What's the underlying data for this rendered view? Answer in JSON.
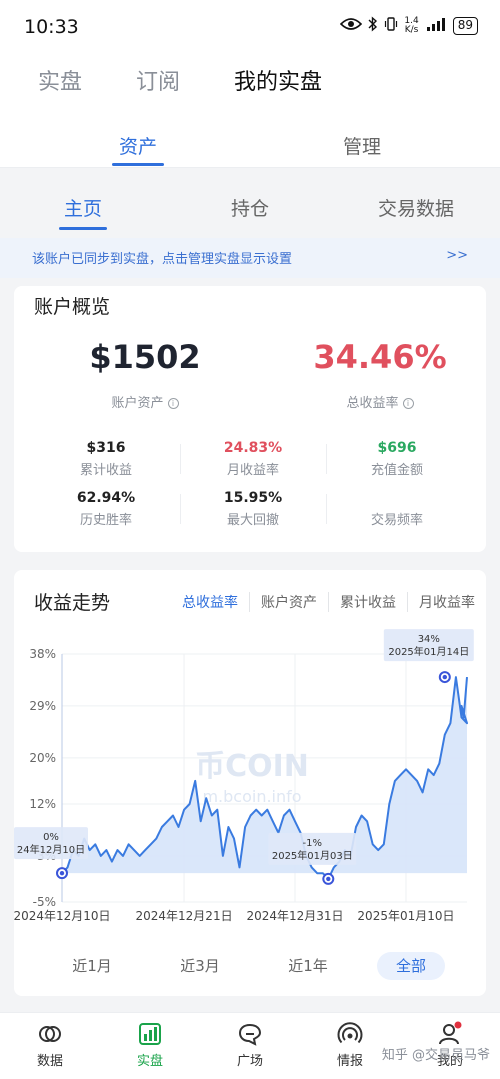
{
  "status": {
    "time": "10:33",
    "speed_top": "1.4",
    "speed_bottom": "K/s",
    "battery": "89"
  },
  "top_nav": {
    "items": [
      "实盘",
      "订阅",
      "我的实盘"
    ],
    "active": 2
  },
  "sub_tabs": [
    "资产",
    "管理"
  ],
  "inner_tabs": [
    "主页",
    "持仓",
    "交易数据"
  ],
  "banner": {
    "text": "该账户已同步到实盘，点击管理实盘显示设置",
    "more": ">>"
  },
  "overview": {
    "title": "账户概览",
    "asset_value": "$1502",
    "asset_label": "账户资产",
    "return_value": "34.46%",
    "return_label": "总收益率",
    "info_glyph": "i",
    "stats": [
      {
        "value": "$316",
        "label": "累计收益",
        "color": "#222222"
      },
      {
        "value": "24.83%",
        "label": "月收益率",
        "color": "#e0505e"
      },
      {
        "value": "$696",
        "label": "充值金额",
        "color": "#2aa860"
      },
      {
        "value": "62.94%",
        "label": "历史胜率",
        "color": "#222222"
      },
      {
        "value": "15.95%",
        "label": "最大回撤",
        "color": "#222222"
      },
      {
        "value": "",
        "label": "交易频率",
        "color": "#222222"
      }
    ]
  },
  "trend": {
    "title": "收益走势",
    "tabs": [
      "总收益率",
      "账户资产",
      "累计收益",
      "月收益率"
    ],
    "ranges": [
      "近1月",
      "近3月",
      "近1年",
      "全部"
    ],
    "active_range": 3
  },
  "chart_data": {
    "type": "area",
    "y_ticks": [
      "38%",
      "29%",
      "20%",
      "12%",
      "3%",
      "-5%"
    ],
    "y_tick_values": [
      38,
      29,
      20,
      12,
      3,
      -5
    ],
    "ylim": [
      -5,
      38
    ],
    "x_ticks": [
      "2024年12月10日",
      "2024年12月21日",
      "2024年12月31日",
      "2025年01月10日"
    ],
    "x_tick_days": [
      0,
      11,
      21,
      31
    ],
    "xlim": [
      0,
      36.5
    ],
    "x": [
      0,
      0.5,
      1,
      1.5,
      2,
      2.5,
      3,
      3.5,
      4,
      4.5,
      5,
      5.5,
      6,
      6.5,
      7,
      7.5,
      8,
      8.5,
      9,
      9.5,
      10,
      10.5,
      11,
      11.5,
      12,
      12.5,
      13,
      13.5,
      14,
      14.5,
      15,
      15.5,
      16,
      16.5,
      17,
      17.5,
      18,
      18.5,
      19,
      19.5,
      20,
      20.5,
      21,
      21.5,
      22,
      22.5,
      23,
      23.5,
      24,
      24.5,
      25,
      25.5,
      26,
      26.5,
      27,
      27.5,
      28,
      28.5,
      29,
      29.5,
      30,
      30.5,
      31,
      31.5,
      32,
      32.5,
      33,
      33.5,
      34,
      34.5,
      35,
      35.5,
      36,
      36.5
    ],
    "y": [
      0,
      1,
      4,
      3,
      6,
      4,
      5,
      3,
      4,
      2,
      4,
      3,
      5,
      4,
      3,
      4,
      5,
      6,
      8,
      9,
      10,
      8,
      11,
      12,
      16,
      9,
      13,
      10,
      11,
      3,
      8,
      6,
      1,
      8,
      10,
      11,
      10,
      11,
      9,
      7,
      10,
      11,
      9,
      7,
      3,
      1,
      0,
      0,
      -1,
      1,
      2,
      4,
      3,
      8,
      10,
      9,
      5,
      4,
      5,
      12,
      16,
      17,
      18,
      17,
      16,
      14,
      18,
      17,
      19,
      24,
      26,
      34,
      27,
      26
    ],
    "y_ext": [
      29,
      27,
      34
    ],
    "x_ext": [
      36.0,
      36.2,
      36.5
    ],
    "area_base": 0,
    "annotations": [
      {
        "label_value": "0%",
        "label_date": "24年12月10日",
        "x": 0,
        "y": 0
      },
      {
        "label_value": "-1%",
        "label_date": "2025年01月03日",
        "x": 24,
        "y": -1
      },
      {
        "label_value": "34%",
        "label_date": "2025年01月14日",
        "x": 34.5,
        "y": 34
      }
    ],
    "colors": {
      "line": "#3a7be0",
      "fill": "#d6e4fa",
      "marker": "#3a55d9"
    },
    "watermark": {
      "logo": "币COIN",
      "url": "m.bcoin.info"
    }
  },
  "bottom_nav": {
    "items": [
      "数据",
      "实盘",
      "广场",
      "情报",
      "我的"
    ],
    "active": 1
  },
  "footer_watermark": "知乎 @交易员马爷"
}
